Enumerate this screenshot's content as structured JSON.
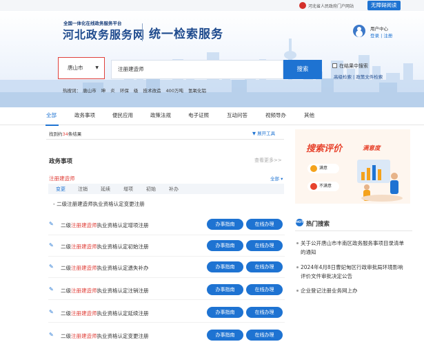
{
  "topbar": {
    "portal_link": "河北省人民政府门户网站",
    "accessibility": "无障碍阅读"
  },
  "brand": {
    "subtitle": "全国一体化在线政务服务平台",
    "name": "河北政务服务网",
    "service": "统一检索服务"
  },
  "user": {
    "center": "用户中心",
    "login": "登录",
    "register": "注册"
  },
  "search": {
    "city": "唐山市",
    "query": "注册建造师",
    "button": "搜索",
    "in_result": "在结果中搜索",
    "advanced": "高级检索",
    "doc_search": "政策文件检索"
  },
  "hot_words": {
    "label": "热搜词：",
    "items": [
      "唐山市",
      "坤",
      "炎",
      "环保",
      "级",
      "技术改造",
      "400万吨",
      "氢氧化铝"
    ]
  },
  "tabs": [
    "全部",
    "政务事项",
    "便民应用",
    "政策法规",
    "电子证照",
    "互动问答",
    "视频导办",
    "其他"
  ],
  "results": {
    "count_prefix": "找到约",
    "count": "34",
    "count_suffix": "条结果",
    "tools": "展开工具"
  },
  "section": {
    "title": "政务事项",
    "more": "查看更多>>",
    "keyword": "注册建造师",
    "all": "全部",
    "subtabs": [
      "变更",
      "注销",
      "延续",
      "增项",
      "初始",
      "补办"
    ],
    "first_item": "二级注册建造师执业资格认定变更注册",
    "guide_label": "办事指南",
    "online_label": "在线办理",
    "rows": [
      {
        "prefix": "二级",
        "highlight": "注册建造师",
        "suffix": "执业资格认定增项注册"
      },
      {
        "prefix": "二级",
        "highlight": "注册建造师",
        "suffix": "执业资格认定初始注册"
      },
      {
        "prefix": "二级",
        "highlight": "注册建造师",
        "suffix": "执业资格认定遗失补办"
      },
      {
        "prefix": "二级",
        "highlight": "注册建造师",
        "suffix": "执业资格认定注销注册"
      },
      {
        "prefix": "二级",
        "highlight": "注册建造师",
        "suffix": "执业资格认定延续注册"
      },
      {
        "prefix": "二级",
        "highlight": "注册建造师",
        "suffix": "执业资格认定变更注册"
      }
    ]
  },
  "banner": {
    "title": "搜索评价",
    "subtitle": "满意度",
    "satisfied": "满意",
    "unsatisfied": "不满意"
  },
  "hot_search": {
    "badge": "HOT",
    "title": "热门搜索",
    "items": [
      "关于公开唐山市丰南区政务服务事项目录清单的通知",
      "2024年4月8日曹妃甸区行政审批局环境影响评价文件审批决定公告",
      "企业登记注册业务网上办"
    ]
  },
  "colors": {
    "brand_blue": "#1e4a8d",
    "accent_blue": "#1e73d2",
    "highlight_red": "#e0403a"
  }
}
